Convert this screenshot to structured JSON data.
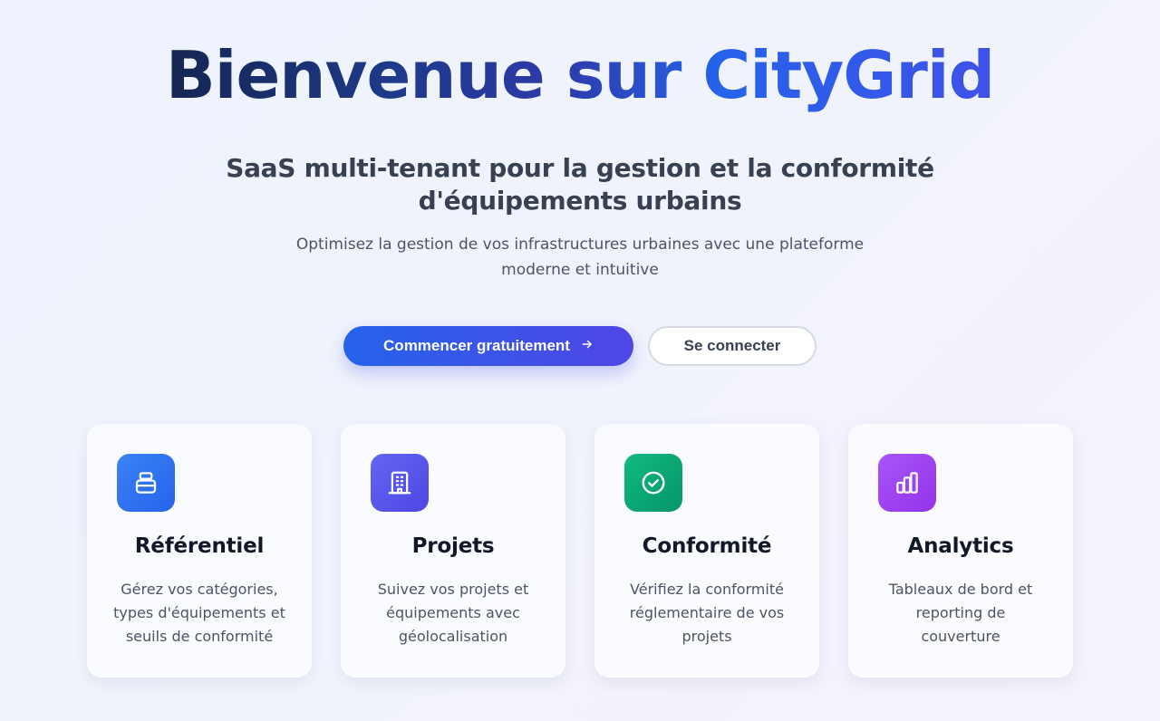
{
  "hero": {
    "headline": "Bienvenue sur CityGrid",
    "subtitle_lines": [
      "SaaS multi-tenant pour la gestion et la conformité",
      "d'équipements urbains"
    ],
    "description_lines": [
      "Optimisez la gestion de vos infrastructures urbaines avec une plateforme",
      "moderne et intuitive"
    ]
  },
  "cta": {
    "primary_label": "Commencer gratuitement",
    "primary_icon": "arrow-right-icon",
    "secondary_label": "Se connecter"
  },
  "features": [
    {
      "title": "Référentiel",
      "icon": "database-icon",
      "color": "#2563eb",
      "desc_lines": [
        "Gérez vos catégories,",
        "types d'équipements et",
        "seuils de conformité"
      ]
    },
    {
      "title": "Projets",
      "icon": "building-icon",
      "color": "#4f46e5",
      "desc_lines": [
        "Suivez vos projets et",
        "équipements avec",
        "géolocalisation"
      ]
    },
    {
      "title": "Conformité",
      "icon": "check-circle-icon",
      "color": "#059669",
      "desc_lines": [
        "Vérifiez la conformité",
        "réglementaire de vos",
        "projets"
      ]
    },
    {
      "title": "Analytics",
      "icon": "bar-chart-icon",
      "color": "#9333ea",
      "desc_lines": [
        "Tableaux de bord et",
        "reporting de",
        "couverture"
      ]
    }
  ],
  "colors": {
    "accent_start": "#2563eb",
    "accent_end": "#4f46e5",
    "headline_dark": "#0f172a"
  }
}
